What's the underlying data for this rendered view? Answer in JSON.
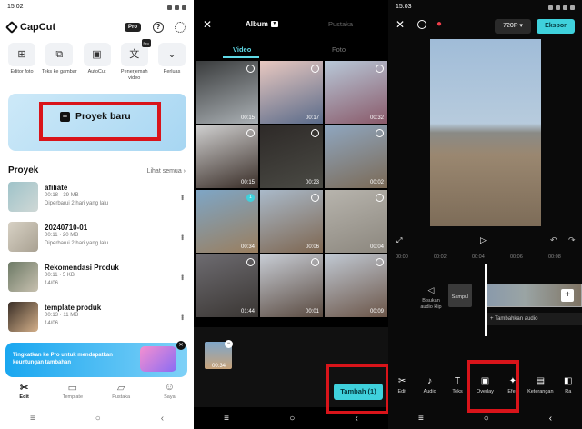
{
  "panel1": {
    "status_time": "15.02",
    "app_name": "CapCut",
    "pro_badge": "Pro",
    "help_icon": "?",
    "tools": [
      {
        "label": "Editor foto",
        "icon": "image-edit-icon",
        "glyph": "⊞",
        "pro": ""
      },
      {
        "label": "Teks ke gambar",
        "icon": "text-to-image-icon",
        "glyph": "⧉",
        "pro": ""
      },
      {
        "label": "AutoCut",
        "icon": "autocut-icon",
        "glyph": "▣",
        "pro": ""
      },
      {
        "label": "Penerjemah video",
        "icon": "translate-icon",
        "glyph": "文",
        "pro": "Pro"
      },
      {
        "label": "Perluas",
        "icon": "chevron-down-icon",
        "glyph": "⌄",
        "pro": ""
      }
    ],
    "new_project": "Proyek baru",
    "projects_title": "Proyek",
    "see_all": "Lihat semua",
    "projects": [
      {
        "name": "afiliate",
        "meta": "00:18 · 39 MB",
        "updated": "Diperbarui 2 hari yang lalu",
        "color1": "#9fc3c9",
        "color2": "#cfd8d6"
      },
      {
        "name": "20240710-01",
        "meta": "00:11 · 20 MB",
        "updated": "Diperbarui 2 hari yang lalu",
        "color1": "#d7d1c4",
        "color2": "#a9a192"
      },
      {
        "name": "Rekomendasi Produk",
        "meta": "00:11 · 5 KB",
        "updated": "14/06",
        "color1": "#6d7a66",
        "color2": "#c8c1b0"
      },
      {
        "name": "template produk",
        "meta": "00:13 · 11 MB",
        "updated": "14/06",
        "color1": "#3a2f27",
        "color2": "#d4b08a"
      }
    ],
    "promo_text": "Tingkatkan ke Pro untuk mendapatkan keuntungan tambahan",
    "tabs": [
      {
        "label": "Edit",
        "glyph": "✂",
        "icon": "scissors-icon",
        "active": true
      },
      {
        "label": "Template",
        "glyph": "▭",
        "icon": "template-icon",
        "active": false
      },
      {
        "label": "Pustaka",
        "glyph": "▱",
        "icon": "folder-icon",
        "active": false
      },
      {
        "label": "Saya",
        "glyph": "☺",
        "icon": "profile-icon",
        "active": false
      }
    ]
  },
  "panel2": {
    "album_label": "Album",
    "library_label": "Pustaka",
    "tab_video": "Video",
    "tab_photo": "Foto",
    "videos": [
      {
        "dur": "00:15",
        "c1": "#3a3c3d",
        "c2": "#aab0b4",
        "sel": ""
      },
      {
        "dur": "00:17",
        "c1": "#e8c8c0",
        "c2": "#5a6b8a",
        "sel": ""
      },
      {
        "dur": "00:32",
        "c1": "#b8c8d8",
        "c2": "#8a5a6a",
        "sel": ""
      },
      {
        "dur": "00:15",
        "c1": "#cfcfcf",
        "c2": "#3a2e28",
        "sel": ""
      },
      {
        "dur": "00:23",
        "c1": "#2e2a28",
        "c2": "#4a4a44",
        "sel": ""
      },
      {
        "dur": "00:02",
        "c1": "#8fa6bf",
        "c2": "#7b6a56",
        "sel": ""
      },
      {
        "dur": "00:34",
        "c1": "#7ea6c6",
        "c2": "#9a7e5e",
        "sel": "1"
      },
      {
        "dur": "00:06",
        "c1": "#a9b9c9",
        "c2": "#7e6650",
        "sel": ""
      },
      {
        "dur": "00:04",
        "c1": "#b7b4ad",
        "c2": "#8c877e",
        "sel": ""
      },
      {
        "dur": "01:44",
        "c1": "#6d6b70",
        "c2": "#3a3633",
        "sel": ""
      },
      {
        "dur": "00:01",
        "c1": "#c7ccd4",
        "c2": "#5a4a40",
        "sel": ""
      },
      {
        "dur": "00:09",
        "c1": "#c0c8d2",
        "c2": "#6b5548",
        "sel": ""
      }
    ],
    "selected_dur": "00:34",
    "add_button": "Tambah (1)"
  },
  "panel3": {
    "status_time": "15.03",
    "resolution": "720P",
    "export": "Ekspor",
    "ruler": [
      "00:00",
      "00:02",
      "00:04",
      "00:06",
      "00:08"
    ],
    "mute_label": "Bisukan audio klip",
    "cover_label": "Sampul",
    "add_audio": "+ Tambahkan audio",
    "tools": [
      {
        "label": "Edit",
        "glyph": "✂",
        "icon": "scissors-icon"
      },
      {
        "label": "Audio",
        "glyph": "♪",
        "icon": "audio-icon"
      },
      {
        "label": "Teks",
        "glyph": "T",
        "icon": "text-icon"
      },
      {
        "label": "Overlay",
        "glyph": "▣",
        "icon": "overlay-icon"
      },
      {
        "label": "Efek",
        "glyph": "✦",
        "icon": "effects-icon"
      },
      {
        "label": "Keterangan",
        "glyph": "▤",
        "icon": "captions-icon"
      },
      {
        "label": "Ra",
        "glyph": "◧",
        "icon": "ratio-icon"
      }
    ]
  },
  "nav": {
    "recent": "≡",
    "home": "○",
    "back": "‹"
  },
  "colors": {
    "accent_cyan": "#3fd1dc",
    "highlight_red": "#d9141a"
  }
}
